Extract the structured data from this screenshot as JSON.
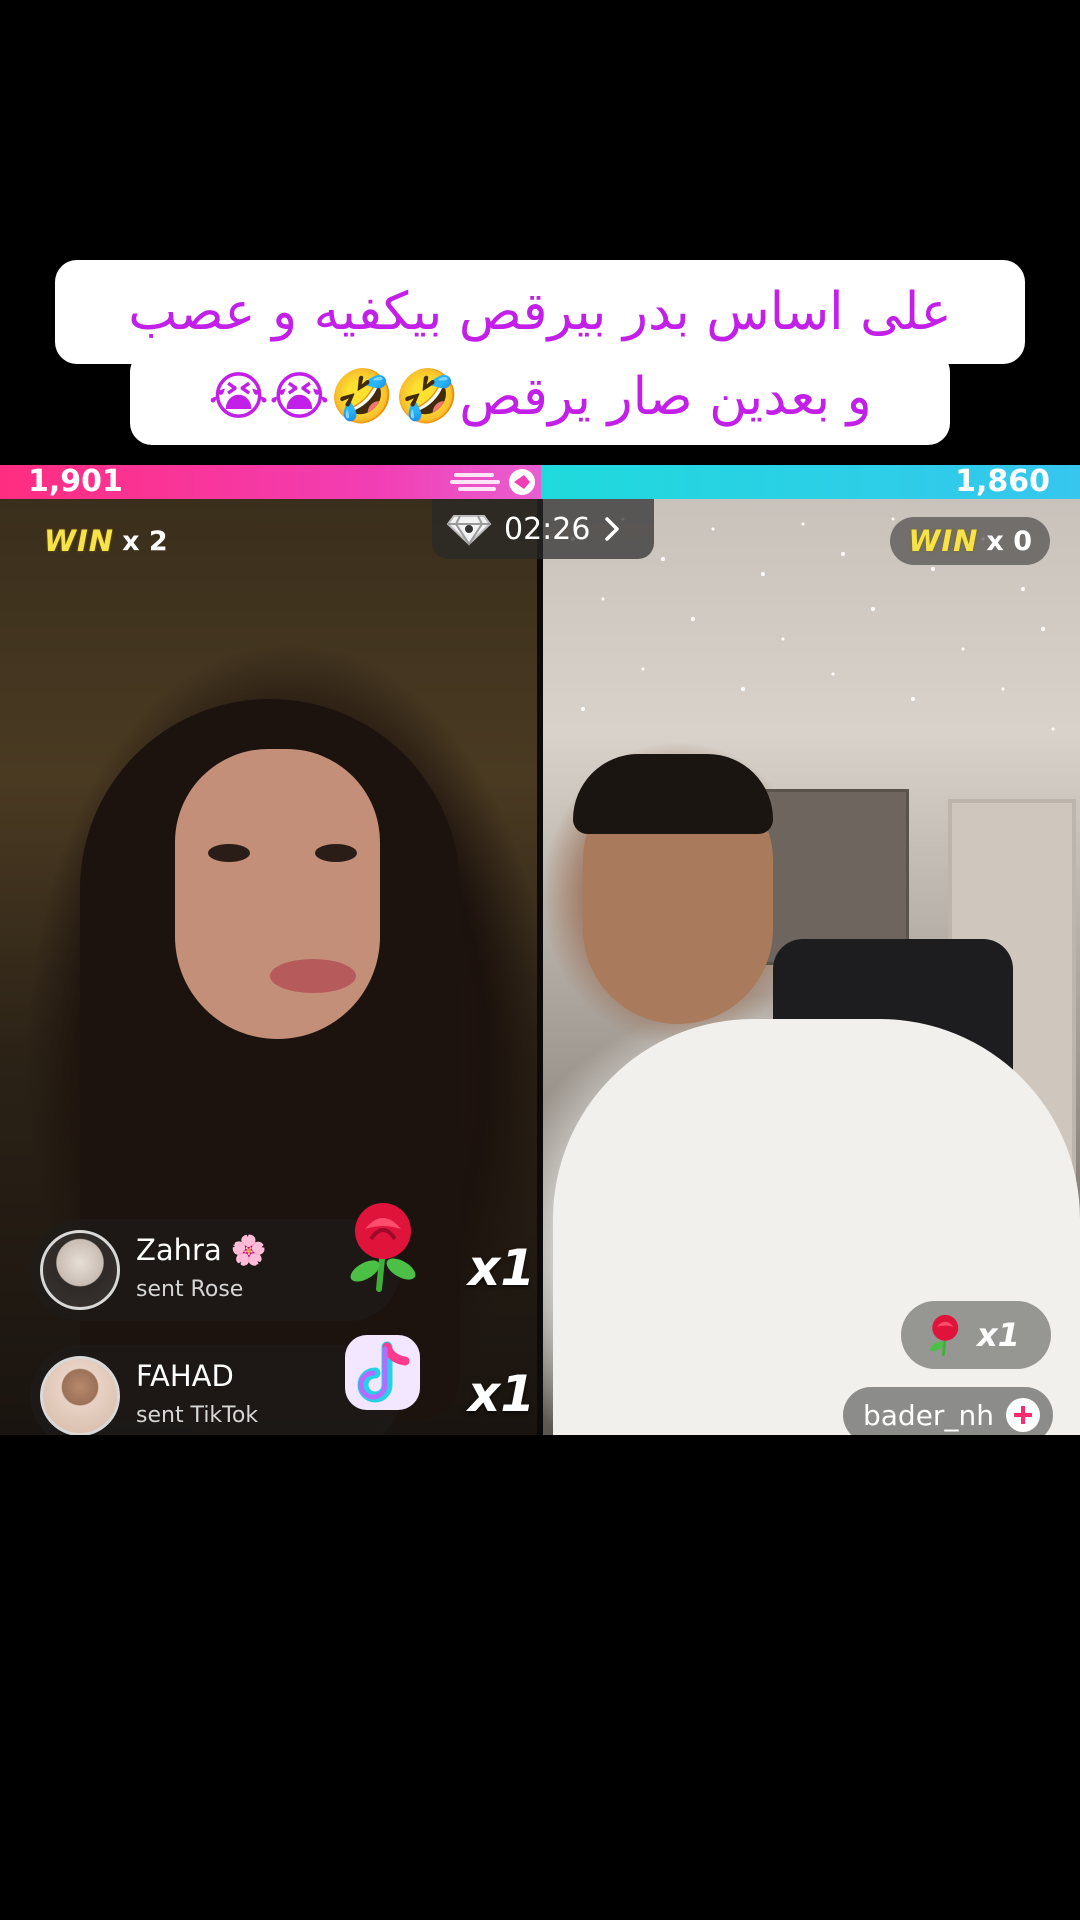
{
  "caption": {
    "line1": "على اساس بدر بيرقص بيكفيه و عصب",
    "line2": "و بعدين صار يرقص🤣🤣😭😭"
  },
  "battle": {
    "left_score": "1,901",
    "right_score": "1,860",
    "left_win_word": "WIN",
    "left_win_count": "x 2",
    "right_win_word": "WIN",
    "right_win_count": "x 0",
    "timer": "02:26",
    "colors": {
      "left_bar": "#ff2d80",
      "right_bar": "#1fdadc",
      "win": "#f6e34a",
      "caption": "#c21fe8"
    }
  },
  "gifts": [
    {
      "name": "Zahra 🌸",
      "action": "sent Rose",
      "icon": "rose-icon",
      "multiplier": "x1"
    },
    {
      "name": "FAHAD",
      "action": "sent TikTok",
      "icon": "tiktok-note-icon",
      "multiplier": "x1"
    }
  ],
  "right_panel": {
    "rose_multiplier": "x1",
    "username": "bader_nh"
  }
}
